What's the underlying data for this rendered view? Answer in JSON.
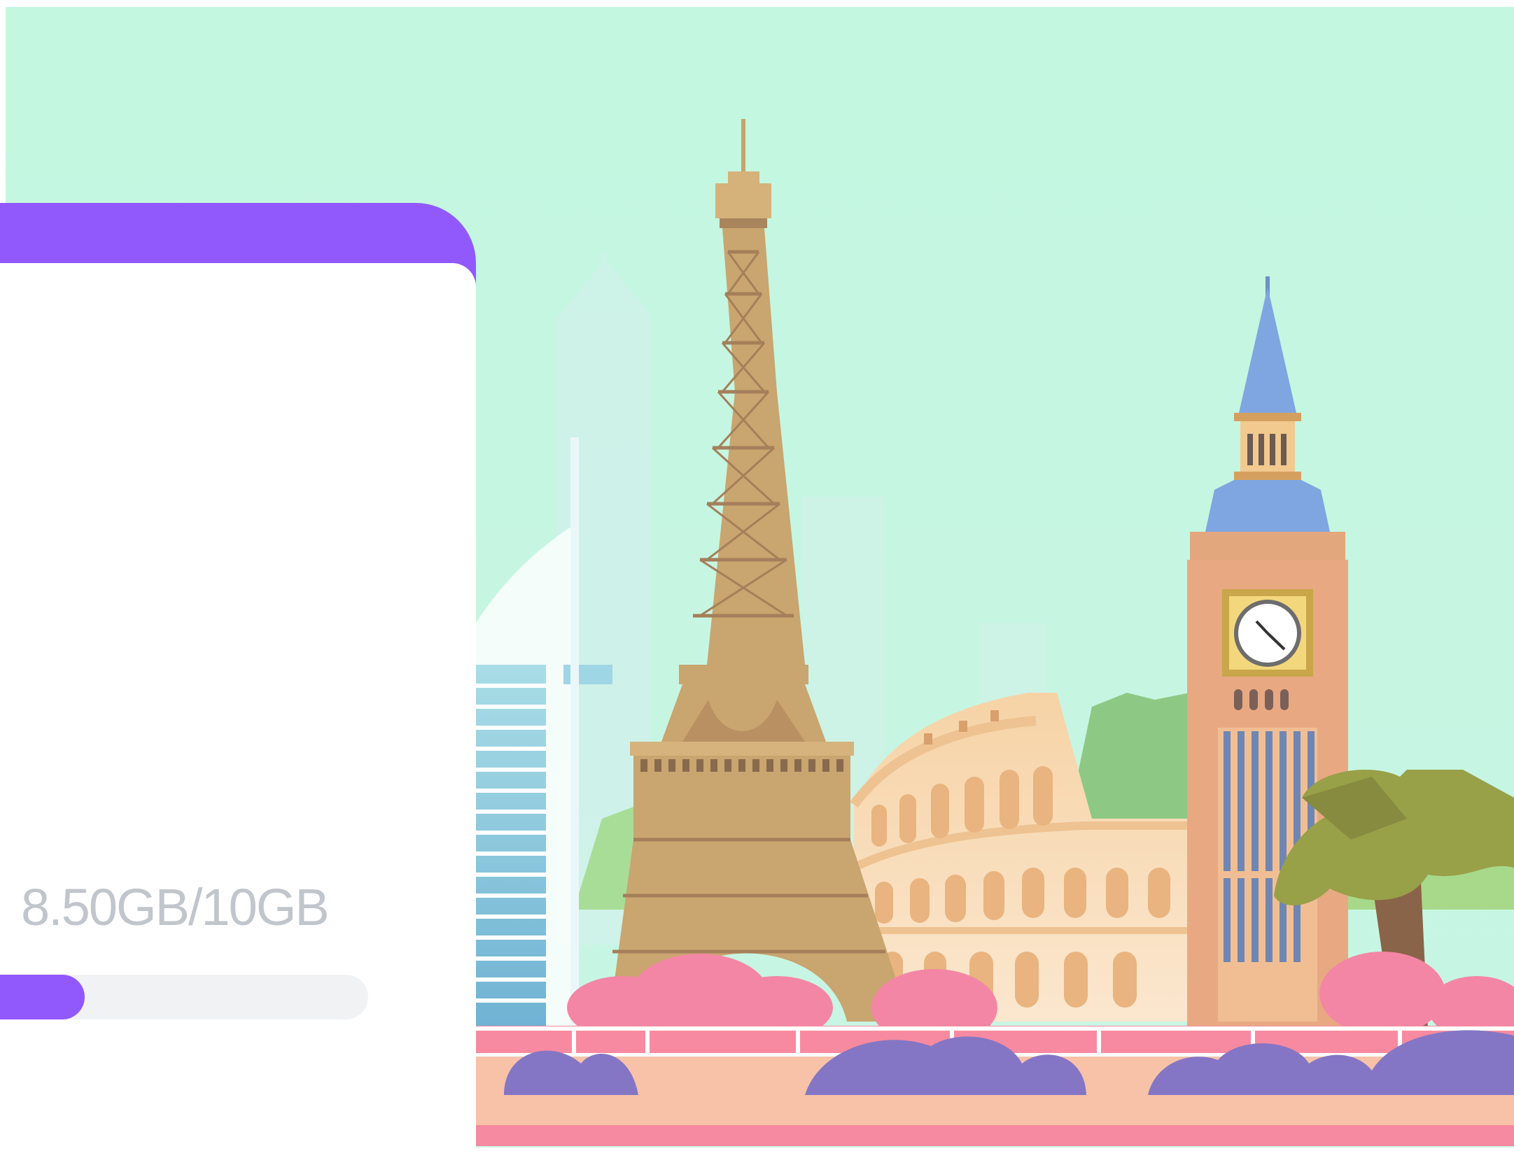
{
  "storage": {
    "usage_label": "8.50GB/10GB",
    "used_gb": 8.5,
    "total_gb": 10,
    "progress_fraction": 0.23
  },
  "colors": {
    "accent": "#9159fc",
    "sky": "#c4f7e1",
    "usage_text": "#c1c5cc",
    "track": "#f1f2f4"
  },
  "illustration": {
    "landmarks": [
      "eiffel-tower",
      "big-ben",
      "colosseum",
      "burj-al-arab",
      "skyscrapers"
    ]
  }
}
